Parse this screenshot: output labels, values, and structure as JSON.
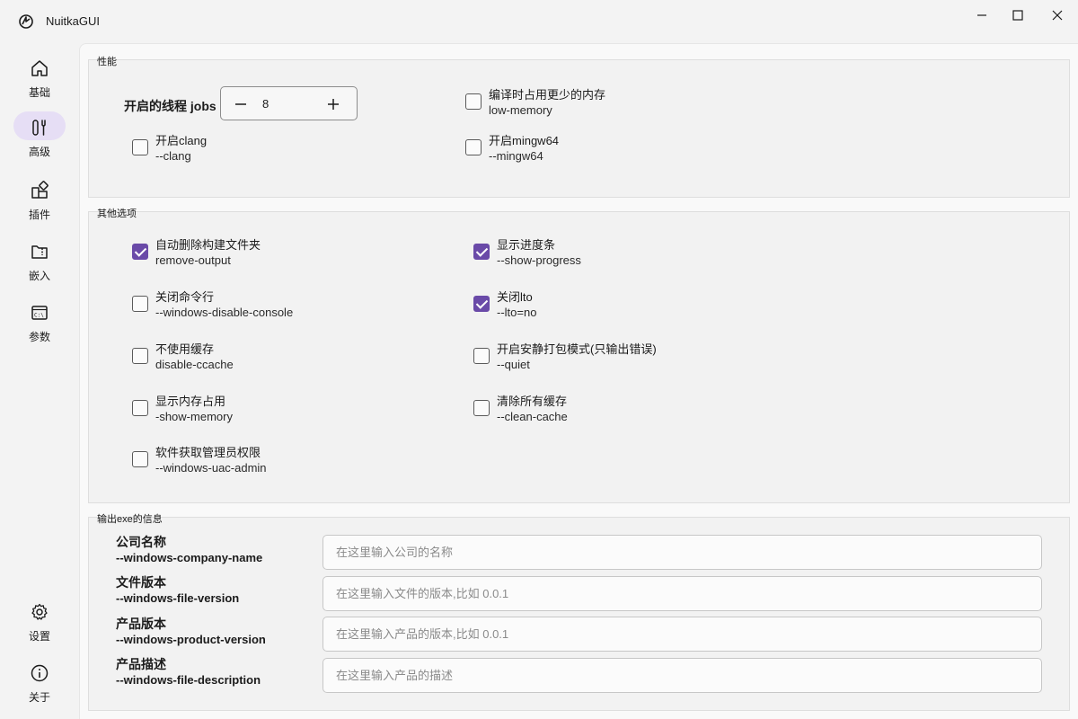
{
  "window": {
    "title": "NuitkaGUI"
  },
  "sidebar": {
    "items": [
      {
        "label": "基础",
        "icon": "home-icon"
      },
      {
        "label": "高级",
        "icon": "tools-icon",
        "active": true
      },
      {
        "label": "插件",
        "icon": "apps-add-icon"
      },
      {
        "label": "嵌入",
        "icon": "folder-zip-icon"
      },
      {
        "label": "参数",
        "icon": "terminal-icon"
      }
    ],
    "bottom": [
      {
        "label": "设置",
        "icon": "gear-icon"
      },
      {
        "label": "关于",
        "icon": "info-icon"
      }
    ]
  },
  "performance": {
    "title": "性能",
    "jobs_label": "开启的线程 jobs",
    "jobs_value": "8",
    "options": [
      {
        "title": "编译时占用更少的内存",
        "sub": "low-memory",
        "checked": false
      },
      {
        "title": "开启clang",
        "sub": "--clang",
        "checked": false
      },
      {
        "title": "开启mingw64",
        "sub": "--mingw64",
        "checked": false
      }
    ]
  },
  "other": {
    "title": "其他选项",
    "options": [
      {
        "title": "自动删除构建文件夹",
        "sub": "remove-output",
        "checked": true
      },
      {
        "title": "显示进度条",
        "sub": "--show-progress",
        "checked": true
      },
      {
        "title": "关闭命令行",
        "sub": "--windows-disable-console",
        "checked": false
      },
      {
        "title": "关闭lto",
        "sub": "--lto=no",
        "checked": true
      },
      {
        "title": "不使用缓存",
        "sub": "disable-ccache",
        "checked": false
      },
      {
        "title": "开启安静打包模式(只输出错误)",
        "sub": "--quiet",
        "checked": false
      },
      {
        "title": "显示内存占用",
        "sub": "-show-memory",
        "checked": false
      },
      {
        "title": "清除所有缓存",
        "sub": "--clean-cache",
        "checked": false
      },
      {
        "title": "软件获取管理员权限",
        "sub": "--windows-uac-admin",
        "checked": false
      }
    ]
  },
  "output": {
    "title": "输出exe的信息",
    "fields": [
      {
        "label": "公司名称",
        "sub": "--windows-company-name",
        "value": "",
        "placeholder": "在这里输入公司的名称"
      },
      {
        "label": "文件版本",
        "sub": "--windows-file-version",
        "value": "",
        "placeholder": "在这里输入文件的版本,比如 0.0.1"
      },
      {
        "label": "产品版本",
        "sub": "--windows-product-version",
        "value": "",
        "placeholder": "在这里输入产品的版本,比如 0.0.1"
      },
      {
        "label": "产品描述",
        "sub": "--windows-file-description",
        "value": "",
        "placeholder": "在这里输入产品的描述"
      }
    ]
  },
  "colors": {
    "accent": "#6a4aa8",
    "active_pill": "#e6def5"
  }
}
